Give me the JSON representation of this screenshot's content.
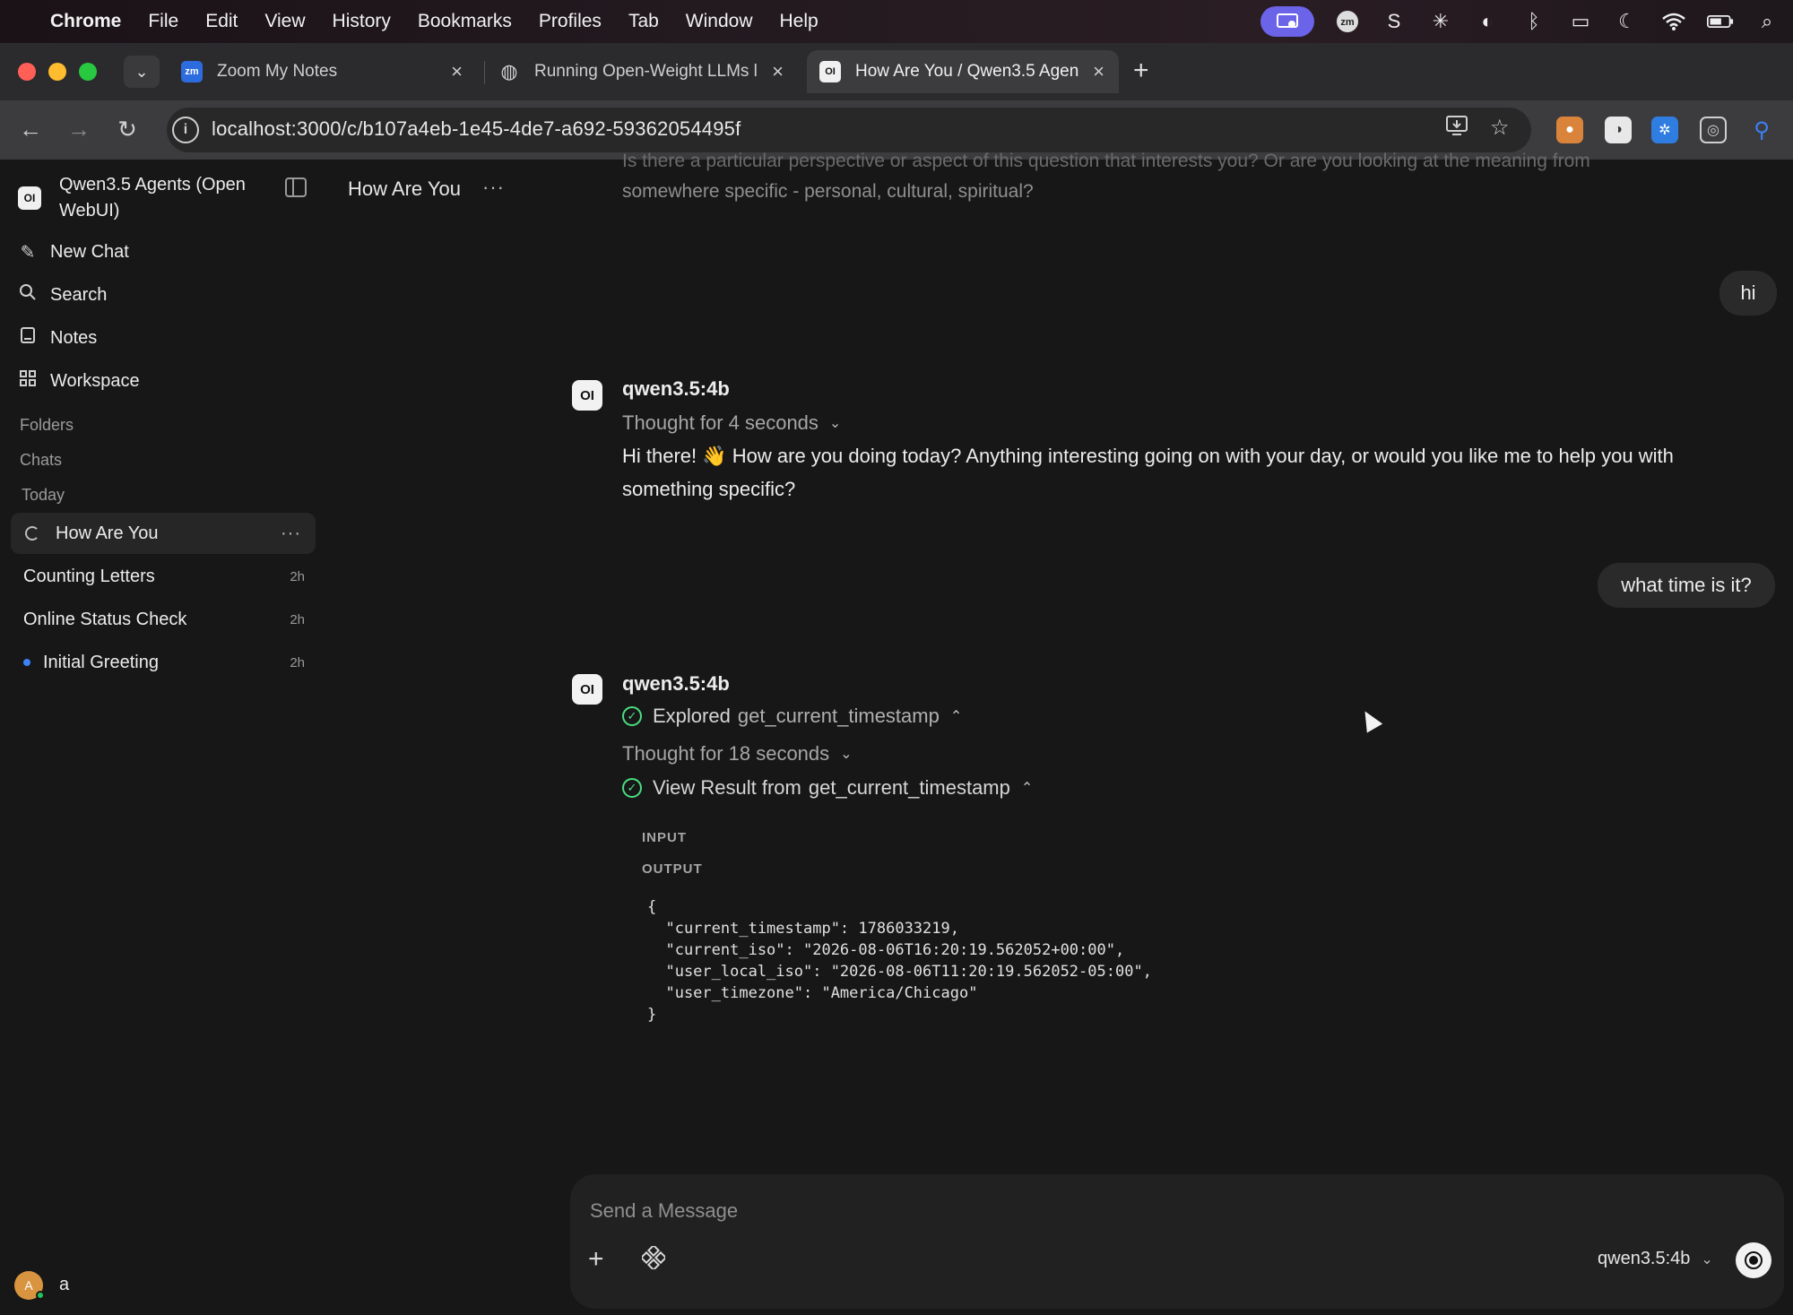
{
  "menubar": {
    "apple_icon": "apple-logo-icon",
    "items": [
      "Chrome",
      "File",
      "Edit",
      "View",
      "History",
      "Bookmarks",
      "Profiles",
      "Tab",
      "Window",
      "Help"
    ],
    "status_icons": [
      "screen-share-icon",
      "zoom-icon",
      "scrobble-icon",
      "brightness-icon",
      "contrast-icon",
      "bluetooth-icon",
      "display-icon",
      "moon-icon",
      "wifi-icon",
      "battery-icon",
      "spotlight-search-icon"
    ]
  },
  "browser": {
    "tabs": [
      {
        "title": "Zoom My Notes",
        "favicon": "zm",
        "active": false
      },
      {
        "title": "Running Open-Weight LLMs l",
        "favicon": "globe",
        "active": false
      },
      {
        "title": "How Are You / Qwen3.5 Agen",
        "favicon": "OI",
        "active": true
      }
    ],
    "url": "localhost:3000/c/b107a4eb-1e45-4de7-a692-59362054495f"
  },
  "sidebar": {
    "app_title": "Qwen3.5 Agents (Open WebUI)",
    "logo": "OI",
    "nav": [
      {
        "label": "New Chat",
        "icon": "pencil-icon"
      },
      {
        "label": "Search",
        "icon": "search-icon"
      },
      {
        "label": "Notes",
        "icon": "notes-icon"
      },
      {
        "label": "Workspace",
        "icon": "workspace-icon"
      }
    ],
    "sections": {
      "folders": "Folders",
      "chats": "Chats",
      "today": "Today"
    },
    "chats": [
      {
        "title": "How Are You",
        "age": "",
        "state": "loading"
      },
      {
        "title": "Counting Letters",
        "age": "2h"
      },
      {
        "title": "Online Status Check",
        "age": "2h"
      },
      {
        "title": "Initial Greeting",
        "age": "2h",
        "unread": true
      }
    ],
    "user": {
      "initial": "A",
      "name": "a"
    }
  },
  "chat": {
    "title": "How Are You",
    "faded_lines": [
      "Is there a particular perspective or aspect of this question that interests you? Or are you looking at the meaning from",
      "somewhere specific - personal, cultural, spiritual?"
    ],
    "messages": [
      {
        "role": "user",
        "text": "hi"
      },
      {
        "role": "assistant",
        "model": "qwen3.5:4b",
        "thought": "Thought for 4 seconds",
        "text": "Hi there! 👋 How are you doing today? Anything interesting going on with your day, or would you like me to help you with something specific?"
      },
      {
        "role": "user",
        "text": "what time is it?"
      },
      {
        "role": "assistant",
        "model": "qwen3.5:4b",
        "explored_label": "Explored",
        "explored_tool": "get_current_timestamp",
        "thought": "Thought for 18 seconds",
        "result_label": "View Result from",
        "result_tool": "get_current_timestamp",
        "input_label": "INPUT",
        "output_label": "OUTPUT",
        "output_code": "{\n  \"current_timestamp\": 1786033219,\n  \"current_iso\": \"2026-08-06T16:20:19.562052+00:00\",\n  \"user_local_iso\": \"2026-08-06T11:20:19.562052-05:00\",\n  \"user_timezone\": \"America/Chicago\"\n}"
      }
    ]
  },
  "composer": {
    "placeholder": "Send a Message",
    "model": "qwen3.5:4b"
  },
  "colors": {
    "accent_green": "#4ade80",
    "unread_dot": "#3b82f6",
    "status_pill": "#6b63e8"
  }
}
